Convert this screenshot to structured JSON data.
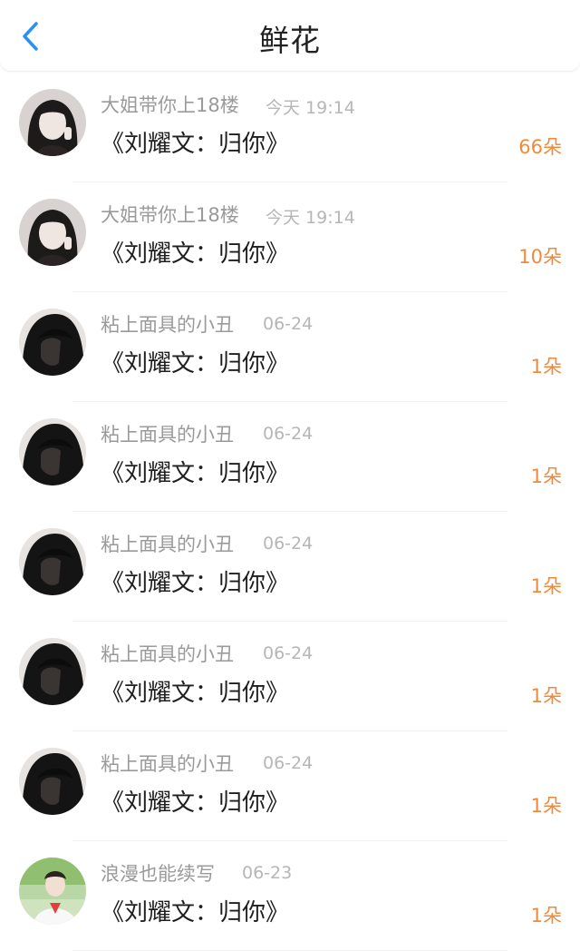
{
  "header": {
    "title": "鲜花",
    "back_icon": "chevron-left-icon",
    "back_color": "#2b90f0"
  },
  "colors": {
    "count": "#f08a3a",
    "name": "#9a9a9a",
    "time": "#b6b6b6",
    "message": "#1e1e1e"
  },
  "items": [
    {
      "name": "大姐带你上18楼",
      "time": "今天 19:14",
      "message": "《刘耀文：归你》",
      "count": "66朵",
      "avatar": "avatar-girl"
    },
    {
      "name": "大姐带你上18楼",
      "time": "今天 19:14",
      "message": "《刘耀文：归你》",
      "count": "10朵",
      "avatar": "avatar-girl"
    },
    {
      "name": "粘上面具的小丑",
      "time": "06-24",
      "message": "《刘耀文：归你》",
      "count": "1朵",
      "avatar": "avatar-hooded"
    },
    {
      "name": "粘上面具的小丑",
      "time": "06-24",
      "message": "《刘耀文：归你》",
      "count": "1朵",
      "avatar": "avatar-hooded"
    },
    {
      "name": "粘上面具的小丑",
      "time": "06-24",
      "message": "《刘耀文：归你》",
      "count": "1朵",
      "avatar": "avatar-hooded"
    },
    {
      "name": "粘上面具的小丑",
      "time": "06-24",
      "message": "《刘耀文：归你》",
      "count": "1朵",
      "avatar": "avatar-hooded"
    },
    {
      "name": "粘上面具的小丑",
      "time": "06-24",
      "message": "《刘耀文：归你》",
      "count": "1朵",
      "avatar": "avatar-hooded"
    },
    {
      "name": "浪漫也能续写",
      "time": "06-23",
      "message": "《刘耀文：归你》",
      "count": "1朵",
      "avatar": "avatar-boy-outdoor"
    }
  ]
}
